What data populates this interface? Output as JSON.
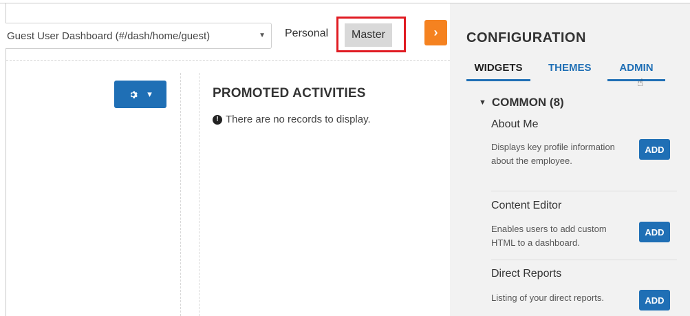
{
  "toolbar": {
    "dashboard_select": "Guest User Dashboard (#/dash/home/guest)",
    "personal_label": "Personal",
    "master_label": "Master",
    "toggle_icon": "chevron-right-icon"
  },
  "main": {
    "settings_icon": "gear-icon",
    "settings_caret": "caret-down-icon",
    "promoted": {
      "title": "PROMOTED ACTIVITIES",
      "empty_text": "There are no records to display."
    }
  },
  "config": {
    "title": "CONFIGURATION",
    "tabs": [
      {
        "label": "WIDGETS",
        "active": true
      },
      {
        "label": "THEMES",
        "active": false
      },
      {
        "label": "ADMIN",
        "active": false
      }
    ],
    "section": {
      "label": "COMMON (8)",
      "expanded": true
    },
    "widgets": [
      {
        "name": "About Me",
        "description": "Displays key profile information about the employee.",
        "action": "ADD"
      },
      {
        "name": "Content Editor",
        "description": "Enables users to add custom HTML to a dashboard.",
        "action": "ADD"
      },
      {
        "name": "Direct Reports",
        "description": "Listing of your direct reports.",
        "action": "ADD"
      }
    ]
  },
  "colors": {
    "accent_blue": "#1f6fb5",
    "orange": "#f58220",
    "highlight_red": "#e01b22",
    "panel_bg": "#f2f2f2"
  }
}
